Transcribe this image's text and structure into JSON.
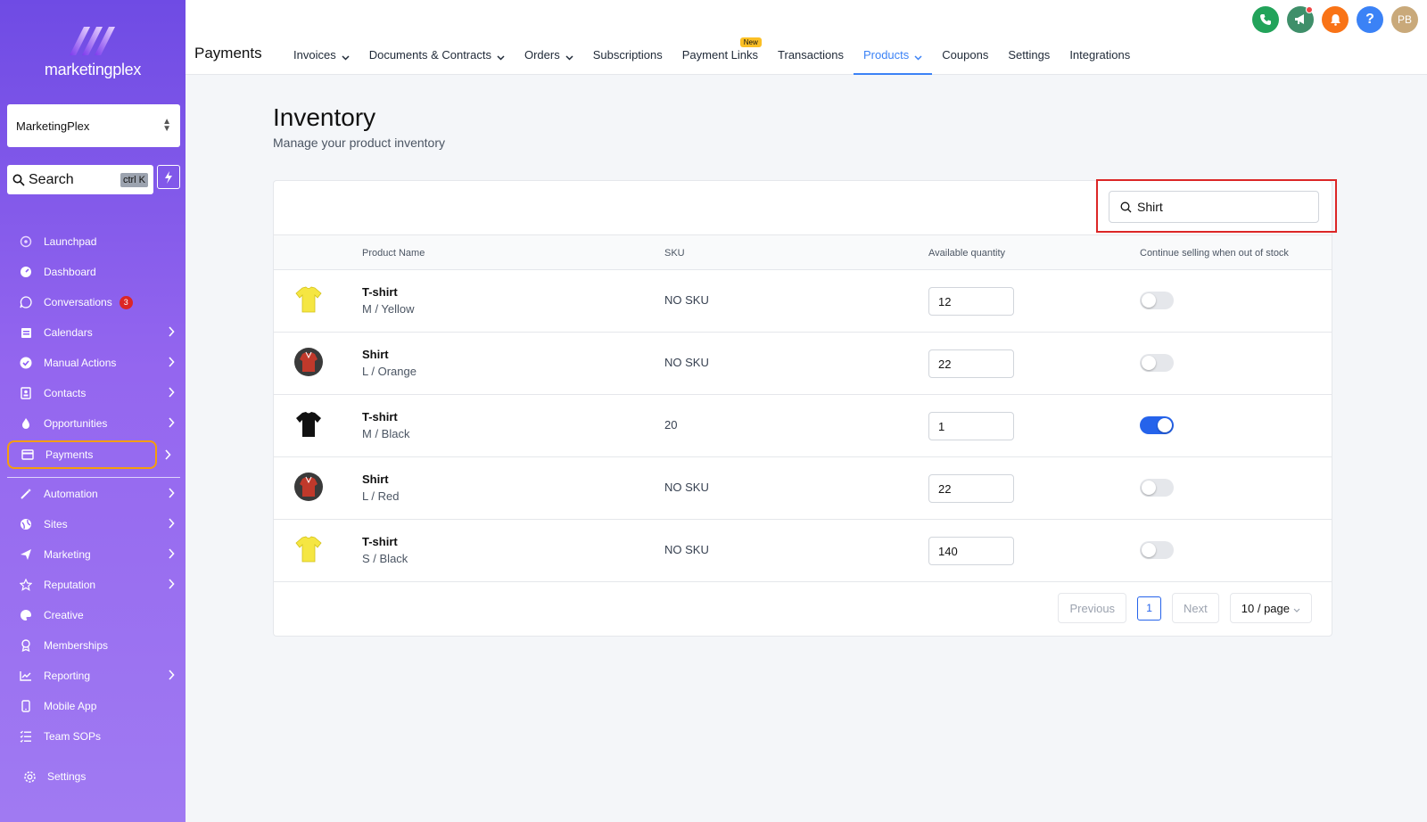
{
  "sidebar": {
    "brand": "marketingplex",
    "account": "MarketingPlex",
    "search_placeholder": "Search",
    "search_shortcut": "ctrl K",
    "items": [
      {
        "label": "Launchpad",
        "icon": "rocket-icon"
      },
      {
        "label": "Dashboard",
        "icon": "gauge-icon"
      },
      {
        "label": "Conversations",
        "icon": "chat-icon",
        "badge": "3"
      },
      {
        "label": "Calendars",
        "icon": "calendar-icon"
      },
      {
        "label": "Manual Actions",
        "icon": "check-circle-icon"
      },
      {
        "label": "Contacts",
        "icon": "contacts-icon"
      },
      {
        "label": "Opportunities",
        "icon": "flame-icon"
      },
      {
        "label": "Payments",
        "icon": "credit-card-icon"
      },
      {
        "label": "Automation",
        "icon": "wand-icon"
      },
      {
        "label": "Sites",
        "icon": "globe-icon"
      },
      {
        "label": "Marketing",
        "icon": "paper-plane-icon"
      },
      {
        "label": "Reputation",
        "icon": "star-icon"
      },
      {
        "label": "Creative",
        "icon": "palette-icon"
      },
      {
        "label": "Memberships",
        "icon": "award-icon"
      },
      {
        "label": "Reporting",
        "icon": "chart-icon"
      },
      {
        "label": "Mobile App",
        "icon": "phone-icon"
      },
      {
        "label": "Team SOPs",
        "icon": "list-icon"
      }
    ],
    "settings_label": "Settings"
  },
  "header": {
    "title": "Payments",
    "tabs": [
      {
        "label": "Invoices"
      },
      {
        "label": "Documents & Contracts"
      },
      {
        "label": "Orders"
      },
      {
        "label": "Subscriptions"
      },
      {
        "label": "Payment Links",
        "pill": "New"
      },
      {
        "label": "Transactions"
      },
      {
        "label": "Products"
      },
      {
        "label": "Coupons"
      },
      {
        "label": "Settings"
      },
      {
        "label": "Integrations"
      }
    ],
    "avatar_initials": "PB",
    "colors": {
      "phone": "#22a35a",
      "megaphone": "#3f8f6a",
      "bell": "#f97316",
      "help": "#3b82f6",
      "avatar": "#c9a97a"
    }
  },
  "main": {
    "title": "Inventory",
    "subtitle": "Manage your product inventory",
    "search_value": "Shirt",
    "columns": {
      "product": "Product Name",
      "sku": "SKU",
      "qty": "Available quantity",
      "continue": "Continue selling when out of stock"
    },
    "rows": [
      {
        "name": "T-shirt",
        "variant": "M / Yellow",
        "sku": "NO SKU",
        "qty": "12",
        "continue": false,
        "thumb": "yellow-tshirt"
      },
      {
        "name": "Shirt",
        "variant": "L / Orange",
        "sku": "NO SKU",
        "qty": "22",
        "continue": false,
        "thumb": "red-shirt"
      },
      {
        "name": "T-shirt",
        "variant": "M / Black",
        "sku": "20",
        "qty": "1",
        "continue": true,
        "thumb": "black-tshirt"
      },
      {
        "name": "Shirt",
        "variant": "L / Red",
        "sku": "NO SKU",
        "qty": "22",
        "continue": false,
        "thumb": "red-shirt"
      },
      {
        "name": "T-shirt",
        "variant": "S / Black",
        "sku": "NO SKU",
        "qty": "140",
        "continue": false,
        "thumb": "yellow-tshirt"
      }
    ],
    "pagination": {
      "previous": "Previous",
      "page": "1",
      "next": "Next",
      "page_size": "10 / page"
    }
  }
}
